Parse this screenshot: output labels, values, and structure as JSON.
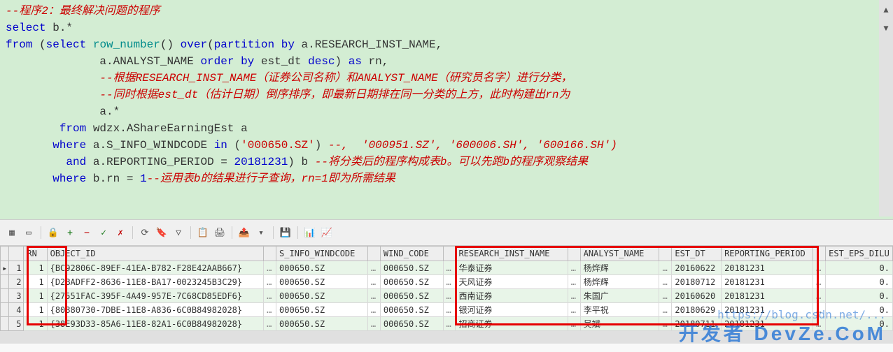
{
  "sql": {
    "pad14": "              ",
    "pad8": "        ",
    "pad7": "       ",
    "pad9": "         ",
    "c1": "--程序2：最终解决问题的程序",
    "l2a": "select",
    "l2b": "b.*",
    "l3a": "from",
    "l3b": "(",
    "l3c": "select",
    "l3d": "row_number",
    "l3e": "()",
    "l3f": "over",
    "l3g": "(",
    "l3h": "partition",
    "l3i": "by",
    "l3j": "a.RESEARCH_INST_NAME,",
    "l4a": "a.ANALYST_NAME",
    "l4b": "order",
    "l4c": "by",
    "l4d": "est_dt",
    "l4e": "desc",
    "l4f": ")",
    "l4g": "as",
    "l4h": "rn,",
    "c2": "--根据RESEARCH_INST_NAME（证券公司名称）和ANALYST_NAME（研究员名字）进行分类，",
    "c3": "--同时根据est_dt（估计日期）倒序排序，即最新日期排在同一分类的上方，此时构建出rn为",
    "l7": "a.*",
    "l8a": "from",
    "l8b": "wdzx.AShareEarningEst a",
    "l9a": "where",
    "l9b": "a.S_INFO_WINDCODE",
    "l9c": "in",
    "l9d": "(",
    "l9e": "'000650.SZ'",
    "l9f": ")",
    "c4": "--,  '000951.SZ', '600006.SH', '600166.SH')",
    "l10a": "and",
    "l10b": "a.REPORTING_PERIOD =",
    "l10c": "20181231",
    "l10d": ") b",
    "c5": "--将分类后的程序构成表b。可以先跑b的程序观察结果",
    "l11a": "where",
    "l11b": "b.rn =",
    "l11c": "1",
    "c6": "--运用表b的结果进行子查询，rn=1即为所需结果"
  },
  "grid": {
    "headers": [
      "RN",
      "OBJECT_ID",
      "S_INFO_WINDCODE",
      "WIND_CODE",
      "RESEARCH_INST_NAME",
      "ANALYST_NAME",
      "EST_DT",
      "REPORTING_PERIOD",
      "EST_EPS_DILU"
    ],
    "rows": [
      {
        "n": "1",
        "rn": "1",
        "obj": "{BC92806C-89EF-41EA-B782-F28E42AAB667}",
        "sinfo": "000650.SZ",
        "wind": "000650.SZ",
        "rin": "华泰证券",
        "ana": "杨烨辉",
        "est": "20160622",
        "rp": "20181231",
        "eps": "0."
      },
      {
        "n": "2",
        "rn": "1",
        "obj": "{D2BADFF2-8636-11E8-BA17-0023245B3C29}",
        "sinfo": "000650.SZ",
        "wind": "000650.SZ",
        "rin": "天风证券",
        "ana": "杨烨辉",
        "est": "20180712",
        "rp": "20181231",
        "eps": "0."
      },
      {
        "n": "3",
        "rn": "1",
        "obj": "{27551FAC-395F-4A49-957E-7C68CD85EDF6}",
        "sinfo": "000650.SZ",
        "wind": "000650.SZ",
        "rin": "西南证券",
        "ana": "朱国广",
        "est": "20160620",
        "rp": "20181231",
        "eps": "0."
      },
      {
        "n": "4",
        "rn": "1",
        "obj": "{80880730-7DBE-11E8-A836-6C0B84982028}",
        "sinfo": "000650.SZ",
        "wind": "000650.SZ",
        "rin": "银河证券",
        "ana": "李平祝",
        "est": "20180629",
        "rp": "20181231",
        "eps": "0."
      },
      {
        "n": "5",
        "rn": "1",
        "obj": "{38E93D33-85A6-11E8-82A1-6C0B84982028}",
        "sinfo": "000650.SZ",
        "wind": "000650.SZ",
        "rin": "招商证券",
        "ana": "吴斌",
        "est": "20180711",
        "rp": "20181231",
        "eps": "0."
      }
    ]
  },
  "watermark": {
    "url": "https://blog.csdn.net/...",
    "logo": "开发者  DevZe.CoM"
  }
}
